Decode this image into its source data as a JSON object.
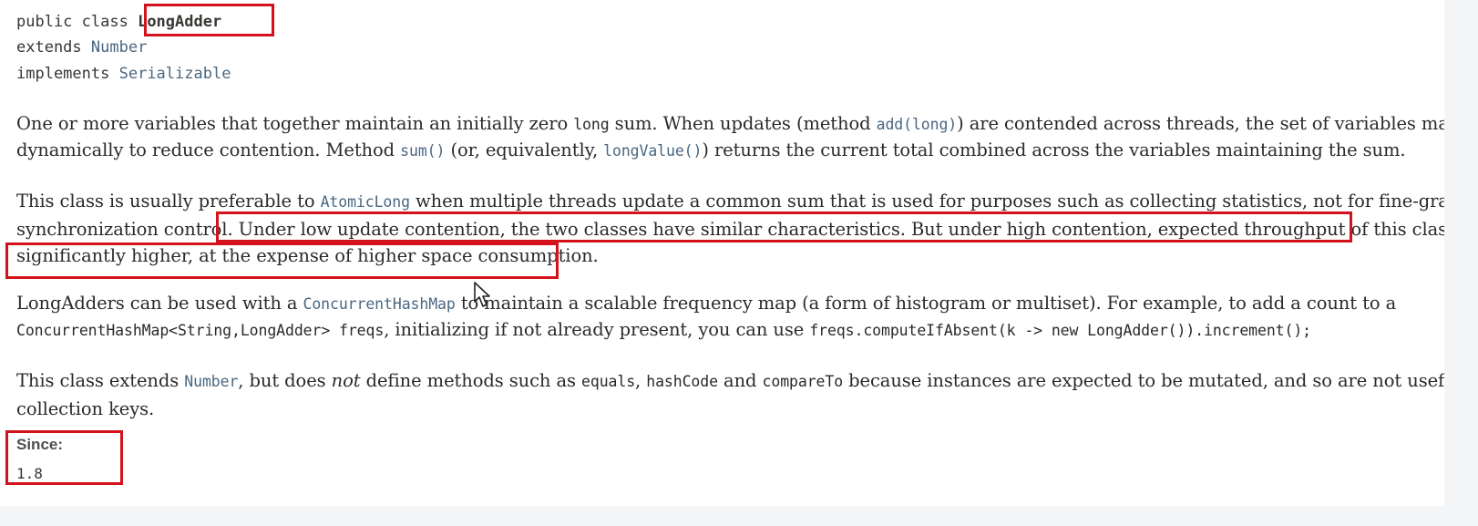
{
  "signature": {
    "kw_class": "public class",
    "class_name": "LongAdder",
    "kw_extends": "extends",
    "extends_type": "Number",
    "kw_implements": "implements",
    "implements_type": "Serializable"
  },
  "para1": {
    "line1_a": "One or more variables that together maintain an initially zero",
    "line1_code1": "long",
    "line1_b": "sum. When updates (method",
    "line1_code2": "add(long)",
    "line1_c": ") are contended across threads, the set of variables may grow",
    "line2_a": "dynamically to reduce contention. Method",
    "line2_code1": "sum()",
    "line2_b": "(or, equivalently,",
    "line2_code2": "longValue()",
    "line2_c": ") returns the current total combined across the variables maintaining the sum."
  },
  "para2": {
    "line1_a": "This class is usually preferable to",
    "line1_link": "AtomicLong",
    "line1_b": "when multiple threads update a common sum that is used for purposes such as collecting statistics, not for fine-grained",
    "line2_a": "synchronization control.",
    "line2_b": "Under low update contention, the two classes have similar characteristics. But under high contention, expected throughput of this class is",
    "line3": "significantly higher, at the expense of higher space consumption."
  },
  "para3": {
    "line1_a": "LongAdders can be used with a",
    "line1_link": "ConcurrentHashMap",
    "line1_b": "to maintain a scalable frequency map (a form of histogram or multiset). For example, to add a count to a",
    "line2_code1": "ConcurrentHashMap<String,LongAdder> freqs",
    "line2_a": ", initializing if not already present, you can use",
    "line2_code2": "freqs.computeIfAbsent(k -> new LongAdder()).increment();"
  },
  "para4": {
    "line1_a": "This class extends",
    "line1_link": "Number",
    "line1_b": ", but does",
    "line1_em": "not",
    "line1_c": "define methods such as",
    "line1_code1": "equals",
    "line1_sep": ",",
    "line1_code2": "hashCode",
    "line1_and": "and",
    "line1_code3": "compareTo",
    "line1_d": "because instances are expected to be mutated, and so are not useful as",
    "line2": "collection keys."
  },
  "since": {
    "label": "Since:",
    "value": "1.8"
  },
  "colors": {
    "highlight": "#d4121b",
    "link": "#4a6782",
    "text": "#2a2a2a"
  },
  "icons": {
    "cursor": "mouse-pointer-icon"
  }
}
